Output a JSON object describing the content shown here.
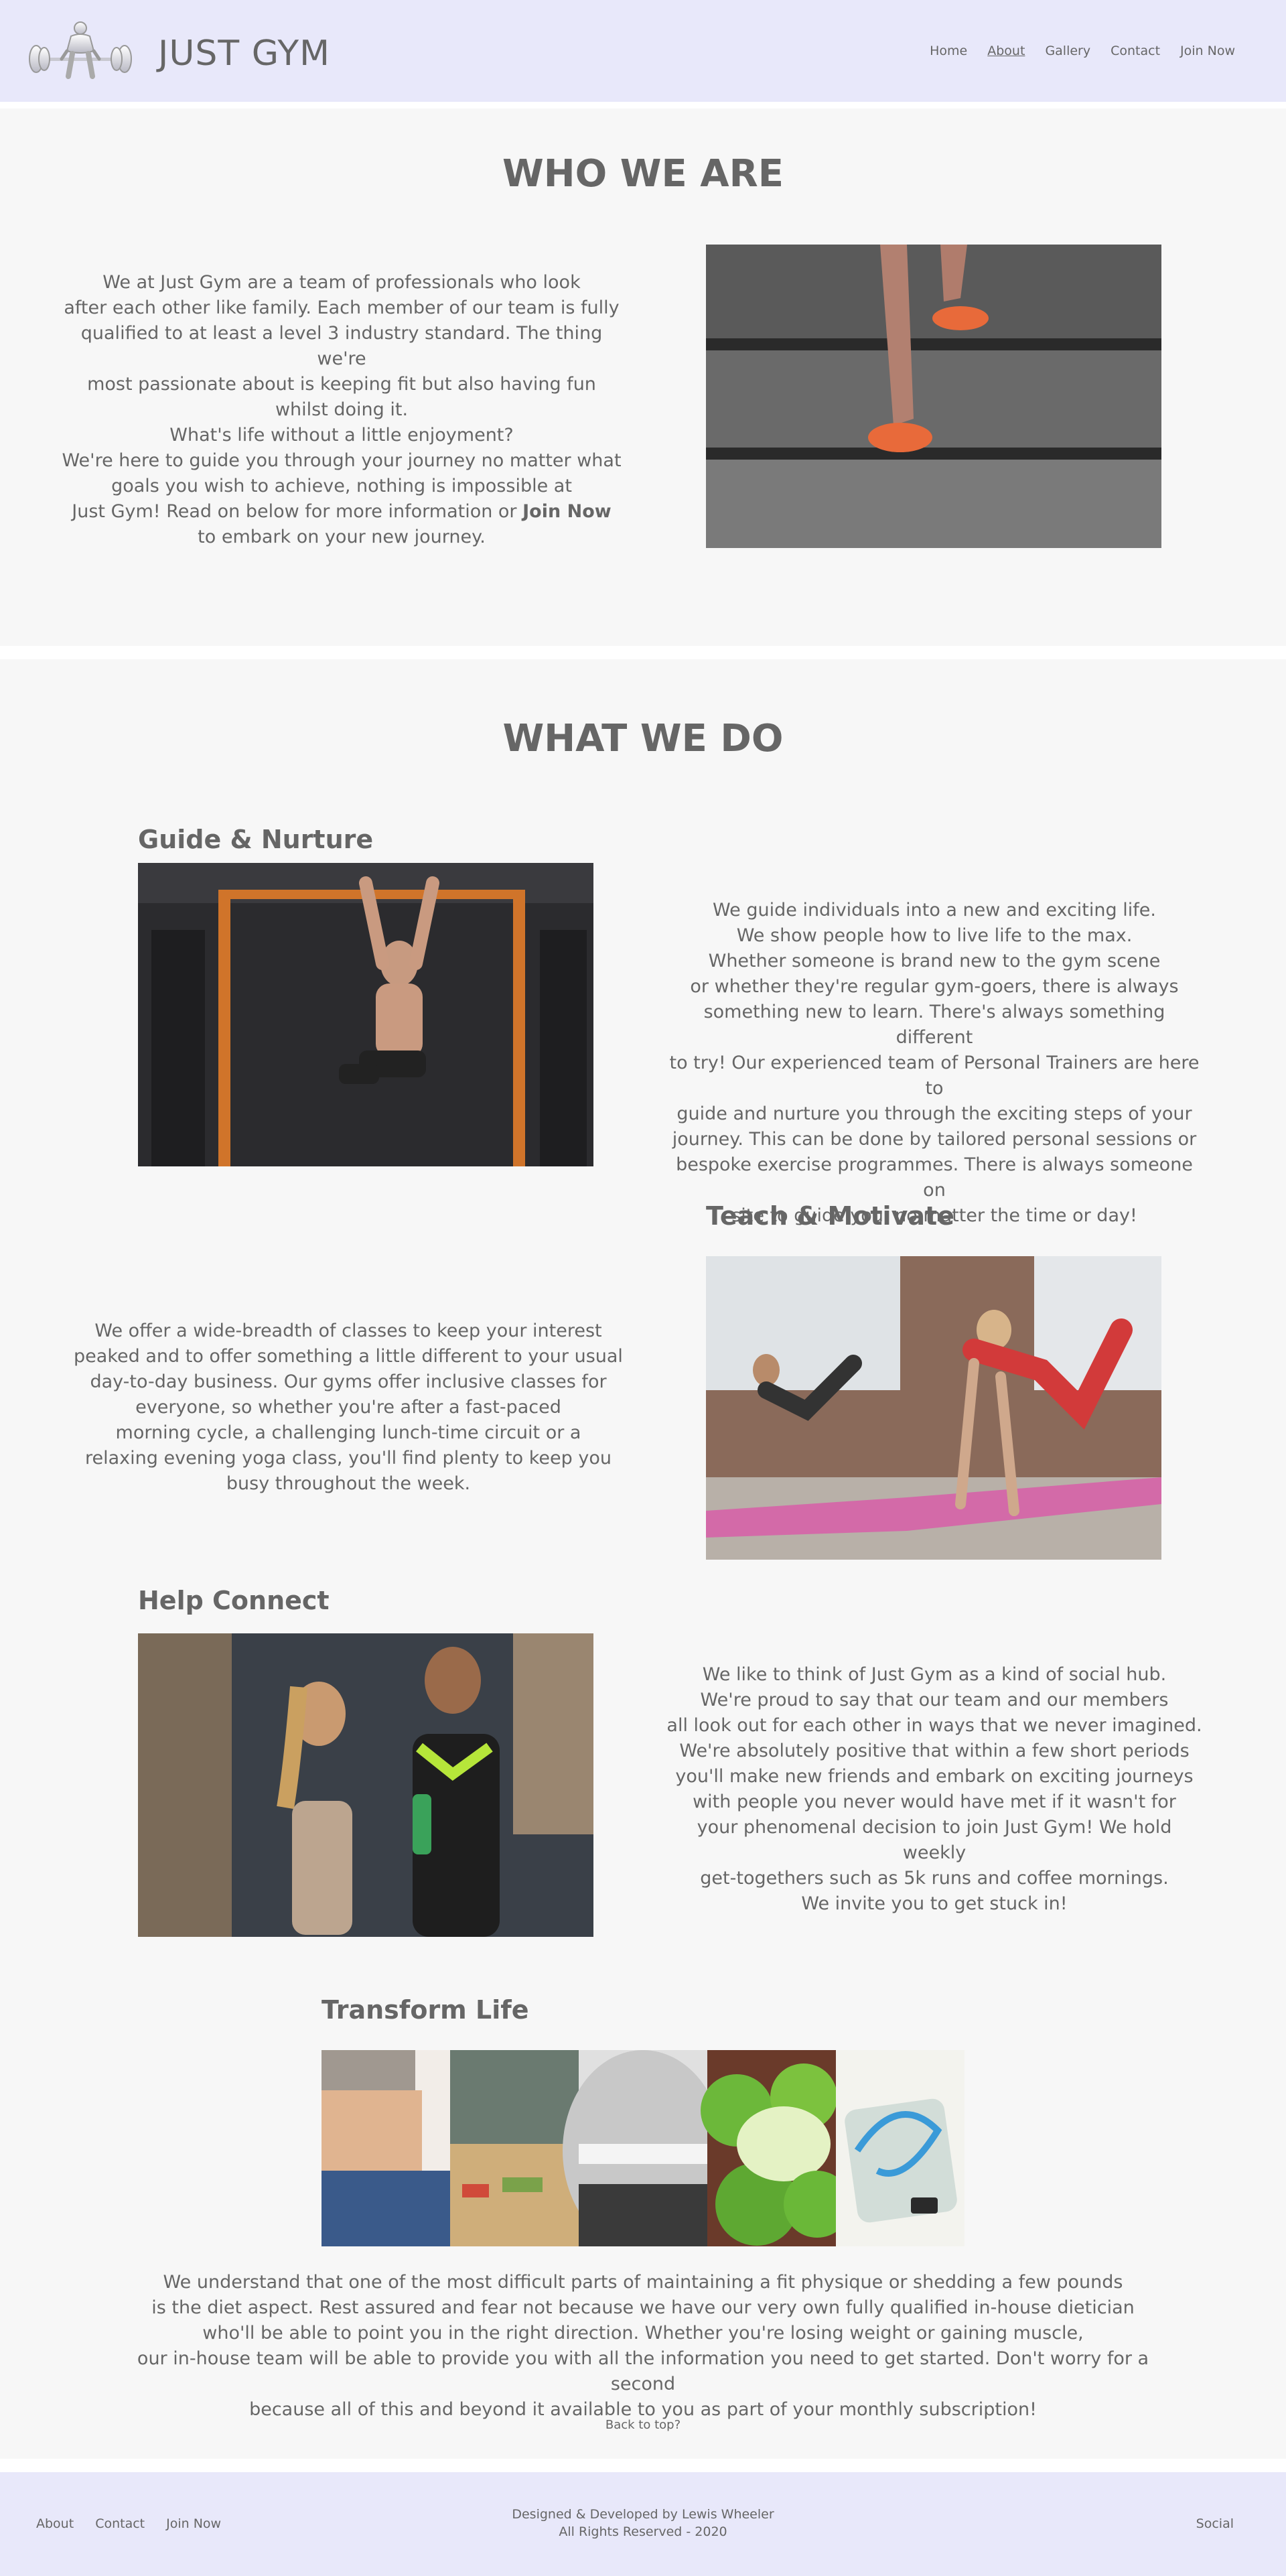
{
  "header": {
    "brand": "JUST GYM",
    "nav": [
      {
        "label": "Home",
        "active": false
      },
      {
        "label": "About",
        "active": true
      },
      {
        "label": "Gallery",
        "active": false
      },
      {
        "label": "Contact",
        "active": false
      },
      {
        "label": "Join Now",
        "active": false
      }
    ]
  },
  "who_we_are": {
    "heading": "WHO WE ARE",
    "paragraph_lines": [
      "We at Just Gym are a team of professionals who look",
      "after each other like family. Each member of our team is fully",
      "qualified to at least a level 3 industry standard. The thing we're",
      "most passionate about is keeping fit but also having fun whilst doing it.",
      "What's life without a little enjoyment?",
      "We're here to guide you through your journey no matter what",
      "goals you wish to achieve, nothing is impossible at",
      "Just Gym! Read on below for more information or",
      "to embark on your new journey."
    ],
    "join_now_bold": "Join Now"
  },
  "what_we_do": {
    "heading": "WHAT WE DO",
    "guide": {
      "title": "Guide & Nurture",
      "lines": [
        "We guide individuals into a new and exciting life.",
        "We show people how to live life to the max.",
        "Whether someone is brand new to the gym scene",
        "or whether they're regular gym-goers, there is always",
        "something new to learn. There's always something different",
        "to try! Our experienced team of Personal Trainers are here to",
        "guide and nurture you through the exciting steps of your",
        "journey. This can be done by tailored personal sessions or",
        "bespoke exercise programmes. There is always someone on",
        "site to guide you, no matter the time or day!"
      ]
    },
    "teach": {
      "title": "Teach & Motivate",
      "lines": [
        "We offer a wide-breadth of classes to keep your interest",
        "peaked and to offer something a little different to your usual",
        "day-to-day business. Our gyms offer inclusive classes for",
        "everyone, so whether you're after a fast-paced",
        "morning cycle, a challenging lunch-time circuit or a",
        "relaxing evening yoga class, you'll find plenty to keep you",
        "busy throughout the week."
      ]
    },
    "connect": {
      "title": "Help Connect",
      "lines": [
        "We like to think of Just Gym as a kind of social hub.",
        "We're proud to say that our team and our members",
        "all look out for each other in ways that we never imagined.",
        "We're absolutely positive that within a few short periods",
        "you'll make new friends and embark on exciting journeys",
        "with people you never would have met if it wasn't for",
        "your phenomenal decision to join Just Gym! We hold weekly",
        "get-togethers such as 5k runs and coffee mornings.",
        "We invite you to get stuck in!"
      ]
    },
    "transform": {
      "title": "Transform Life",
      "lines": [
        "We understand that one of the most difficult parts of maintaining a fit physique or shedding a few pounds",
        "is the diet aspect. Rest assured and fear not because we have our very own fully qualified in-house dietician",
        "who'll be able to point you in the right direction. Whether you're losing weight or gaining muscle,",
        "our in-house team will be able to provide you with all the information you need to get started. Don't worry for a second",
        "because all of this and beyond it available to you as part of your monthly subscription!"
      ]
    },
    "back_to_top": "Back to top?"
  },
  "footer": {
    "links": [
      "About",
      "Contact",
      "Join Now"
    ],
    "credit_line1": "Designed & Developed by Lewis Wheeler",
    "credit_line2": "All Rights Reserved - 2020",
    "social": "Social"
  },
  "icons": {
    "logo": "barbell-lifter-logo"
  },
  "colors": {
    "header_bg": "#e8e8fa",
    "section_bg": "#f7f7f7",
    "text": "#666666"
  }
}
